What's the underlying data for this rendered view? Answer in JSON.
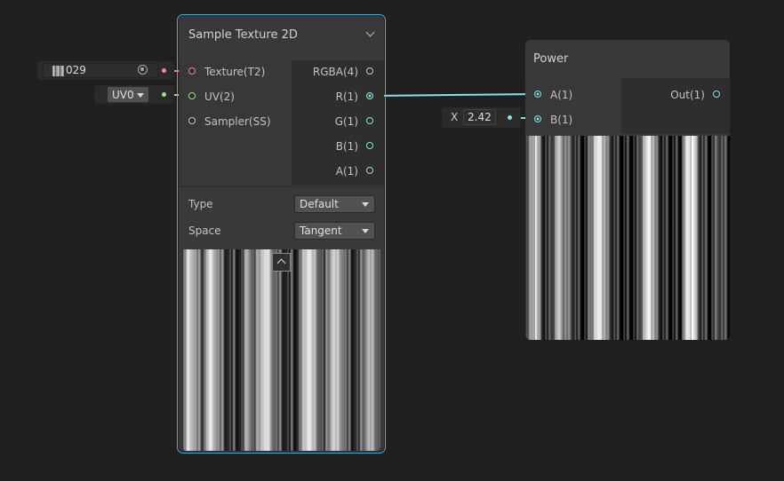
{
  "sample_node": {
    "title": "Sample Texture 2D",
    "inputs": [
      {
        "label": "Texture(T2)",
        "color": "#f08c8c"
      },
      {
        "label": "UV(2)",
        "color": "#9ce28a"
      },
      {
        "label": "Sampler(SS)",
        "color": "#c8c8c8"
      }
    ],
    "outputs": [
      "RGBA(4)",
      "R(1)",
      "G(1)",
      "B(1)",
      "A(1)"
    ],
    "settings": {
      "type_label": "Type",
      "type_value": "Default",
      "space_label": "Space",
      "space_value": "Tangent"
    }
  },
  "texture_input": {
    "value": "029"
  },
  "uv_input": {
    "value": "UV0"
  },
  "power_node": {
    "title": "Power",
    "inputs": [
      "A(1)",
      "B(1)"
    ],
    "outputs": [
      "Out(1)"
    ]
  },
  "b_input": {
    "axis": "X",
    "value": "2.42"
  },
  "colors": {
    "edge": "#84e4e7",
    "selection": "#44b0e0",
    "background": "#202020"
  }
}
